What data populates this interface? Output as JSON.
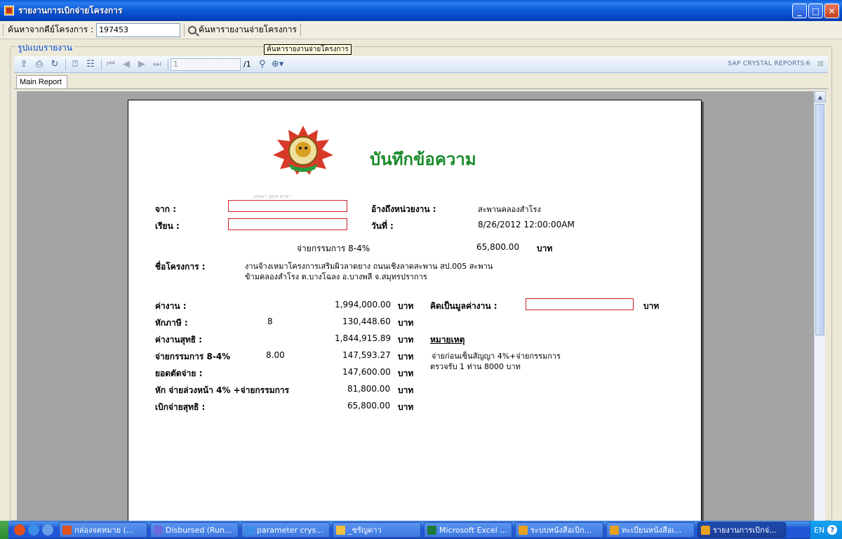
{
  "window": {
    "title": "รายงานการเบิกจ่ายโครงการ",
    "minimize": "_",
    "maximize": "□",
    "close": "✕"
  },
  "search": {
    "label": "ค้นหาจากคีย์โครงการ :",
    "value": "197453",
    "button_label": "ค้นหารายงานจ่ายโครงการ"
  },
  "group": {
    "legend": "รูปแบบรายงาน"
  },
  "tooltip": "ค้นหารายงานจ่ายโครงการ",
  "viewer": {
    "page_input": "1",
    "page_total": "/1",
    "brand": "SAP CRYSTAL REPORTS®",
    "close": "⊠",
    "tab": "Main Report"
  },
  "report": {
    "heading": "บันทึกข้อความ",
    "faint_text": "เกษมา สุขส อาสา",
    "from_label": "จาก :",
    "to_label": "เรียน :",
    "ref_label": "อ้างถึงหน่วยงาน :",
    "ref_value": "สะพานคลองสำโรง",
    "date_label": "วันที่ :",
    "date_value": "8/26/2012  12:00:00AM",
    "fee_label": "จ่ายกรรมการ 8-4%",
    "fee_amount": "65,800.00",
    "baht": "บาท",
    "project_label": "ชื่อโครงการ :",
    "project_line1": "งานจ้างเหมาโครงการเสริมผิวลาดยาง ถนนเชิงลาดสะพาน สป.005 สะพาน",
    "project_line2": "ข้ามคลองสำโรง ต.บางโฉลง อ.บางพลี จ.สมุทรปราการ",
    "rows": [
      {
        "label": "ค่างาน :",
        "mid": "",
        "amount": "1,994,000.00",
        "unit": "บาท"
      },
      {
        "label": "หักภาษี :",
        "mid": "8",
        "amount": "130,448.60",
        "unit": "บาท"
      },
      {
        "label": "ค่างานสุทธิ :",
        "mid": "",
        "amount": "1,844,915.89",
        "unit": "บาท"
      },
      {
        "label": "จ่ายกรรมการ 8-4%",
        "mid": "8.00",
        "amount": "147,593.27",
        "unit": "บาท"
      },
      {
        "label": "ยอดตัดจ่าย :",
        "mid": "",
        "amount": "147,600.00",
        "unit": "บาท"
      },
      {
        "label": "หัก จ่ายล่วงหน้า 4% +จ่ายกรรมการ",
        "mid": "",
        "amount": "81,800.00",
        "unit": "บาท"
      },
      {
        "label": "เบิกจ่ายสุทธิ :",
        "mid": "",
        "amount": "65,800.00",
        "unit": "บาท"
      }
    ],
    "value_label": "คิดเป็นมูลค่างาน :",
    "value_unit": "บาท",
    "remark_label": "หมายเหตุ",
    "remark_line1": "จ่ายก่อนเซ็นสัญญา 4%+จ่ายกรรมการ",
    "remark_line2": "ตรวจรับ 1 ท่าน 8000 บาท"
  },
  "taskbar": {
    "tasks": [
      {
        "label": "กล่องจดหมาย (...",
        "icon_color": "#e0501c"
      },
      {
        "label": "Disbursed (Run...",
        "icon_color": "#6a6ad8"
      },
      {
        "label": "parameter crys...",
        "icon_color": "#3a8ee6"
      },
      {
        "label": "_ชรัญดาว",
        "icon_color": "#f0c040"
      },
      {
        "label": "Microsoft Excel ...",
        "icon_color": "#1e7a3a"
      },
      {
        "label": "ระบบหนังสือเบิก...",
        "icon_color": "#e8a020"
      },
      {
        "label": "ทะเบียนหนังสือเ...",
        "icon_color": "#e8a020"
      },
      {
        "label": "รายงานการเบิกจ่...",
        "icon_color": "#e8a020"
      }
    ],
    "lang": "EN",
    "help": "?"
  }
}
